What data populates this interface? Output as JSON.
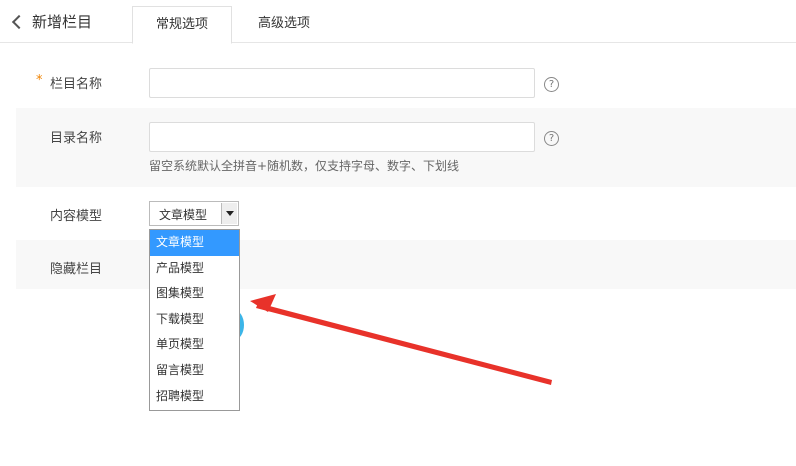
{
  "header": {
    "back_title": "新增栏目",
    "tabs": [
      {
        "label": "常规选项",
        "active": true
      },
      {
        "label": "高级选项",
        "active": false
      }
    ]
  },
  "form": {
    "column_name": {
      "required_mark": "*",
      "label": "栏目名称",
      "help": "?"
    },
    "directory_name": {
      "label": "目录名称",
      "help": "?",
      "hint": "留空系统默认全拼音+随机数，仅支持字母、数字、下划线"
    },
    "content_model": {
      "label": "内容模型",
      "selected": "文章模型"
    },
    "hidden_column": {
      "label": "隐藏栏目"
    }
  },
  "dropdown": {
    "options": [
      "文章模型",
      "产品模型",
      "图集模型",
      "下载模型",
      "单页模型",
      "留言模型",
      "招聘模型"
    ],
    "selected_index": 0
  },
  "colors": {
    "accent": "#3399ff",
    "required": "#f08300",
    "annotation_arrow": "#e8322a"
  }
}
